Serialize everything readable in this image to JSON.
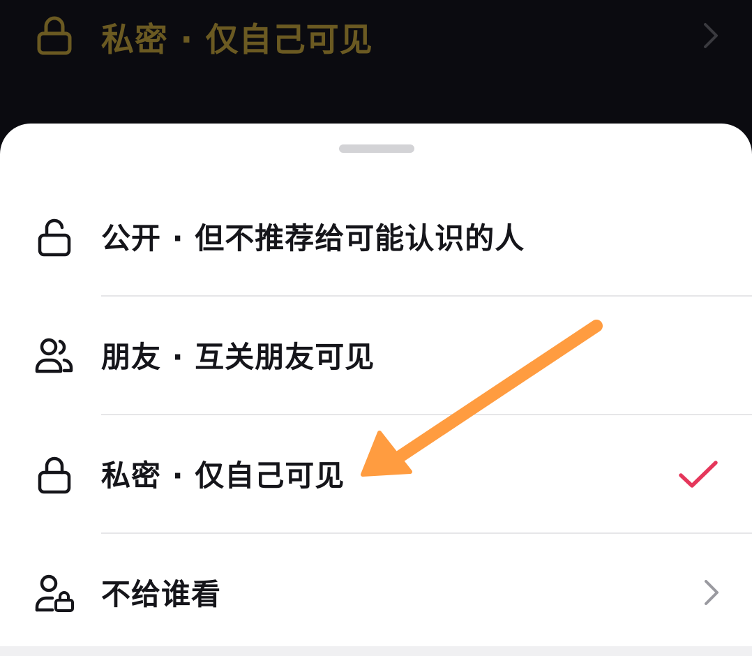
{
  "background": {
    "current_selection_label": "私密 · 仅自己可见",
    "icon": "lock-icon",
    "chevron": "chevron-right-icon"
  },
  "sheet": {
    "options": [
      {
        "label": "公开 · 但不推荐给可能认识的人",
        "icon": "unlock-icon",
        "selected": false,
        "has_chevron": false
      },
      {
        "label": "朋友 · 互关朋友可见",
        "icon": "friends-icon",
        "selected": false,
        "has_chevron": false
      },
      {
        "label": "私密 · 仅自己可见",
        "icon": "lock-icon",
        "selected": true,
        "has_chevron": false
      },
      {
        "label": "不给谁看",
        "icon": "user-lock-icon",
        "selected": false,
        "has_chevron": true
      }
    ]
  },
  "colors": {
    "background": "#0b0b10",
    "dimmed_text": "#6b5a22",
    "check": "#e5375b",
    "annotation_arrow": "#ff9c40"
  },
  "annotation": {
    "type": "arrow",
    "points_to": "私密 · 仅自己可见"
  }
}
